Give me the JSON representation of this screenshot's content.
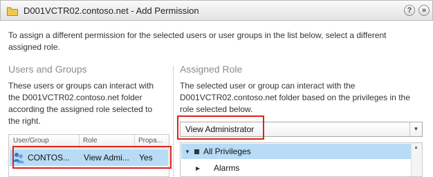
{
  "window": {
    "title": "D001VCTR02.contoso.net - Add Permission",
    "help_label": "?",
    "close_label": "»"
  },
  "intro": {
    "line1": "To assign a different permission for the selected users or user groups in the list below, select a different",
    "line2": "assigned role."
  },
  "users_groups": {
    "title": "Users and Groups",
    "desc_lines": [
      "These users or groups can interact with",
      "the D001VCTR02.contoso.net folder",
      "according the assigned role selected to",
      "the right."
    ],
    "columns": [
      "User/Group",
      "Role",
      "Propa..."
    ],
    "rows": [
      {
        "user": "CONTOS...",
        "role": "View Admi...",
        "propagate": "Yes",
        "icon": "user-group-icon"
      }
    ]
  },
  "assigned_role": {
    "title": "Assigned Role",
    "desc_lines": [
      "The selected user or group can interact with the",
      "D001VCTR02.contoso.net folder based on the privileges in the",
      "role selected below."
    ],
    "selected_role": "View Administrator",
    "privileges": [
      {
        "label": "All Privileges",
        "expanded": true
      },
      {
        "label": "Alarms",
        "expanded": false
      }
    ]
  },
  "colors": {
    "selection": "#b8dcf5",
    "highlight_box": "#d9231d",
    "section_title": "#8c8c8c"
  }
}
